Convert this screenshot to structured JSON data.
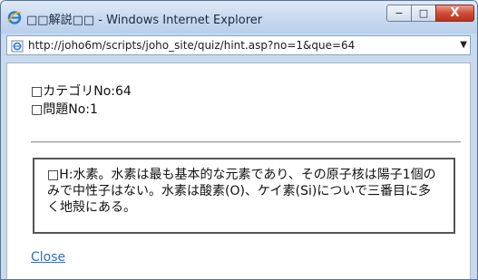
{
  "window": {
    "title": "□□解説□□ - Windows Internet Explorer",
    "controls": {
      "minimize": "−",
      "maximize": "□",
      "close": "X"
    }
  },
  "address_bar": {
    "url": "http://joho6m/scripts/joho_site/quiz/hint.asp?no=1&que=64"
  },
  "page": {
    "category_line": "□カテゴリNo:64",
    "question_line": "□問題No:1",
    "hint_text": "□H:水素。水素は最も基本的な元素であり、その原子核は陽子1個のみで中性子はない。水素は酸素(O)、ケイ素(Si)についで三番目に多く地殻にある。",
    "close_link": "Close"
  },
  "colors": {
    "titlebar": "#c7d9ef",
    "close_button": "#d04c34",
    "link": "#2a6fc9"
  },
  "icons": [
    "ie-icon",
    "page-icon",
    "dropdown-arrow-icon"
  ]
}
